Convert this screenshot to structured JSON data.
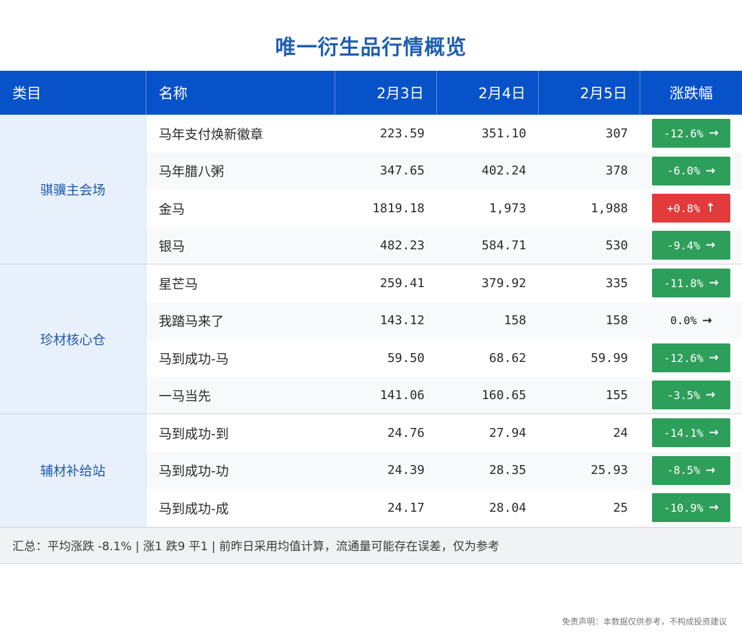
{
  "title": "唯一衍生品行情概览",
  "colors": {
    "header": "#0752c9",
    "up": "#e23b3b",
    "down": "#2e9e5b",
    "title": "#1f5fb0"
  },
  "headers": [
    "类目",
    "名称",
    "2月3日",
    "2月4日",
    "2月5日",
    "涨跌幅"
  ],
  "categories": [
    "骐骥主会场",
    "珍材核心仓",
    "辅材补给站"
  ],
  "rows": [
    {
      "name": "马年支付焕新徽章",
      "d1": "223.59",
      "d2": "351.10",
      "d3": "307",
      "change": "-12.6%",
      "arrow": "→",
      "status": "down"
    },
    {
      "name": "马年腊八粥",
      "d1": "347.65",
      "d2": "402.24",
      "d3": "378",
      "change": "-6.0%",
      "arrow": "→",
      "status": "down"
    },
    {
      "name": "金马",
      "d1": "1819.18",
      "d2": "1,973",
      "d3": "1,988",
      "change": "+0.8%",
      "arrow": "↑",
      "status": "up"
    },
    {
      "name": "银马",
      "d1": "482.23",
      "d2": "584.71",
      "d3": "530",
      "change": "-9.4%",
      "arrow": "→",
      "status": "down"
    },
    {
      "name": "星芒马",
      "d1": "259.41",
      "d2": "379.92",
      "d3": "335",
      "change": "-11.8%",
      "arrow": "→",
      "status": "down"
    },
    {
      "name": "我踏马来了",
      "d1": "143.12",
      "d2": "158",
      "d3": "158",
      "change": "0.0%",
      "arrow": "→",
      "status": "flat"
    },
    {
      "name": "马到成功-马",
      "d1": "59.50",
      "d2": "68.62",
      "d3": "59.99",
      "change": "-12.6%",
      "arrow": "→",
      "status": "down"
    },
    {
      "name": "一马当先",
      "d1": "141.06",
      "d2": "160.65",
      "d3": "155",
      "change": "-3.5%",
      "arrow": "→",
      "status": "down"
    },
    {
      "name": "马到成功-到",
      "d1": "24.76",
      "d2": "27.94",
      "d3": "24",
      "change": "-14.1%",
      "arrow": "→",
      "status": "down"
    },
    {
      "name": "马到成功-功",
      "d1": "24.39",
      "d2": "28.35",
      "d3": "25.93",
      "change": "-8.5%",
      "arrow": "→",
      "status": "down"
    },
    {
      "name": "马到成功-成",
      "d1": "24.17",
      "d2": "28.04",
      "d3": "25",
      "change": "-10.9%",
      "arrow": "→",
      "status": "down"
    }
  ],
  "summary": "汇总：平均涨跌 -8.1% | 涨1 跌9 平1 | 前昨日采用均值计算，流通量可能存在误差，仅为参考",
  "disclaimer": "免责声明：本数据仅供参考，不构成投资建议"
}
